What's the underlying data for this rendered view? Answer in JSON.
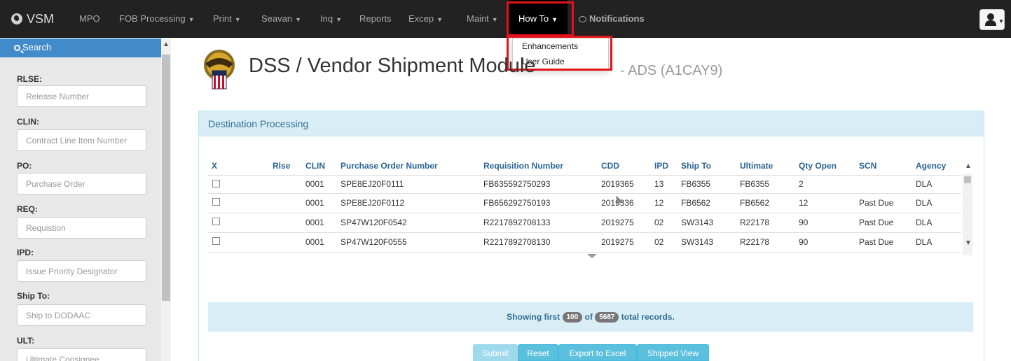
{
  "nav": {
    "brand": "VSM",
    "items": [
      {
        "label": "MPO",
        "caret": false
      },
      {
        "label": "FOB Processing",
        "caret": true
      },
      {
        "label": "Print",
        "caret": true
      },
      {
        "label": "Seavan",
        "caret": true
      },
      {
        "label": "Inq",
        "caret": true
      },
      {
        "label": "Reports",
        "caret": false
      },
      {
        "label": "Excep",
        "caret": true
      },
      {
        "label": "Maint",
        "caret": true
      },
      {
        "label": "How To",
        "caret": true,
        "active": true
      },
      {
        "label": "Notifications",
        "caret": false
      }
    ],
    "dropdown": [
      "Enhancements",
      "User Guide"
    ]
  },
  "sidebar": {
    "title": "Search",
    "fields": [
      {
        "label": "RLSE:",
        "placeholder": "Release Number"
      },
      {
        "label": "CLIN:",
        "placeholder": "Contract Line Item Number"
      },
      {
        "label": "PO:",
        "placeholder": "Purchase Order"
      },
      {
        "label": "REQ:",
        "placeholder": "Requistion"
      },
      {
        "label": "IPD:",
        "placeholder": "Issue Priority Designator"
      },
      {
        "label": "Ship To:",
        "placeholder": "Ship to DODAAC"
      },
      {
        "label": "ULT:",
        "placeholder": "Ultimate Consignee"
      }
    ]
  },
  "header": {
    "title": "DSS / Vendor Shipment Module",
    "subtitle": "- ADS (A1CAY9)"
  },
  "panel": {
    "title": "Destination Processing"
  },
  "table": {
    "columns": [
      "X",
      "Rlse",
      "CLIN",
      "Purchase Order Number",
      "Requisition Number",
      "CDD",
      "IPD",
      "Ship To",
      "Ultimate",
      "Qty Open",
      "SCN",
      "Agency"
    ],
    "rows": [
      {
        "clin": "0001",
        "po": "SPE8EJ20F0111",
        "req": "FB635592750293",
        "cdd": "2019365",
        "ipd": "13",
        "ship_to": "FB6355",
        "ultimate": "FB6355",
        "qty": "2",
        "scn": "",
        "agency": "DLA"
      },
      {
        "clin": "0001",
        "po": "SPE8EJ20F0112",
        "req": "FB656292750193",
        "cdd": "2019336",
        "ipd": "12",
        "ship_to": "FB6562",
        "ultimate": "FB6562",
        "qty": "12",
        "scn": "Past Due",
        "agency": "DLA"
      },
      {
        "clin": "0001",
        "po": "SP47W120F0542",
        "req": "R2217892708133",
        "cdd": "2019275",
        "ipd": "02",
        "ship_to": "SW3143",
        "ultimate": "R22178",
        "qty": "90",
        "scn": "Past Due",
        "agency": "DLA"
      },
      {
        "clin": "0001",
        "po": "SP47W120F0555",
        "req": "R2217892708130",
        "cdd": "2019275",
        "ipd": "02",
        "ship_to": "SW3143",
        "ultimate": "R22178",
        "qty": "90",
        "scn": "Past Due",
        "agency": "DLA"
      }
    ]
  },
  "info": {
    "prefix": "Showing first",
    "shown": "100",
    "middle": "of",
    "total": "5687",
    "suffix": "total records."
  },
  "buttons": {
    "submit": "Submit",
    "reset": "Reset",
    "export": "Export to Excel",
    "shipped": "Shipped View"
  },
  "colors": {
    "navbar": "#222222",
    "highlight": "#e3121b",
    "sidebar_head": "#428bca",
    "panel_head": "#d9edf7",
    "button": "#5bc0de"
  }
}
